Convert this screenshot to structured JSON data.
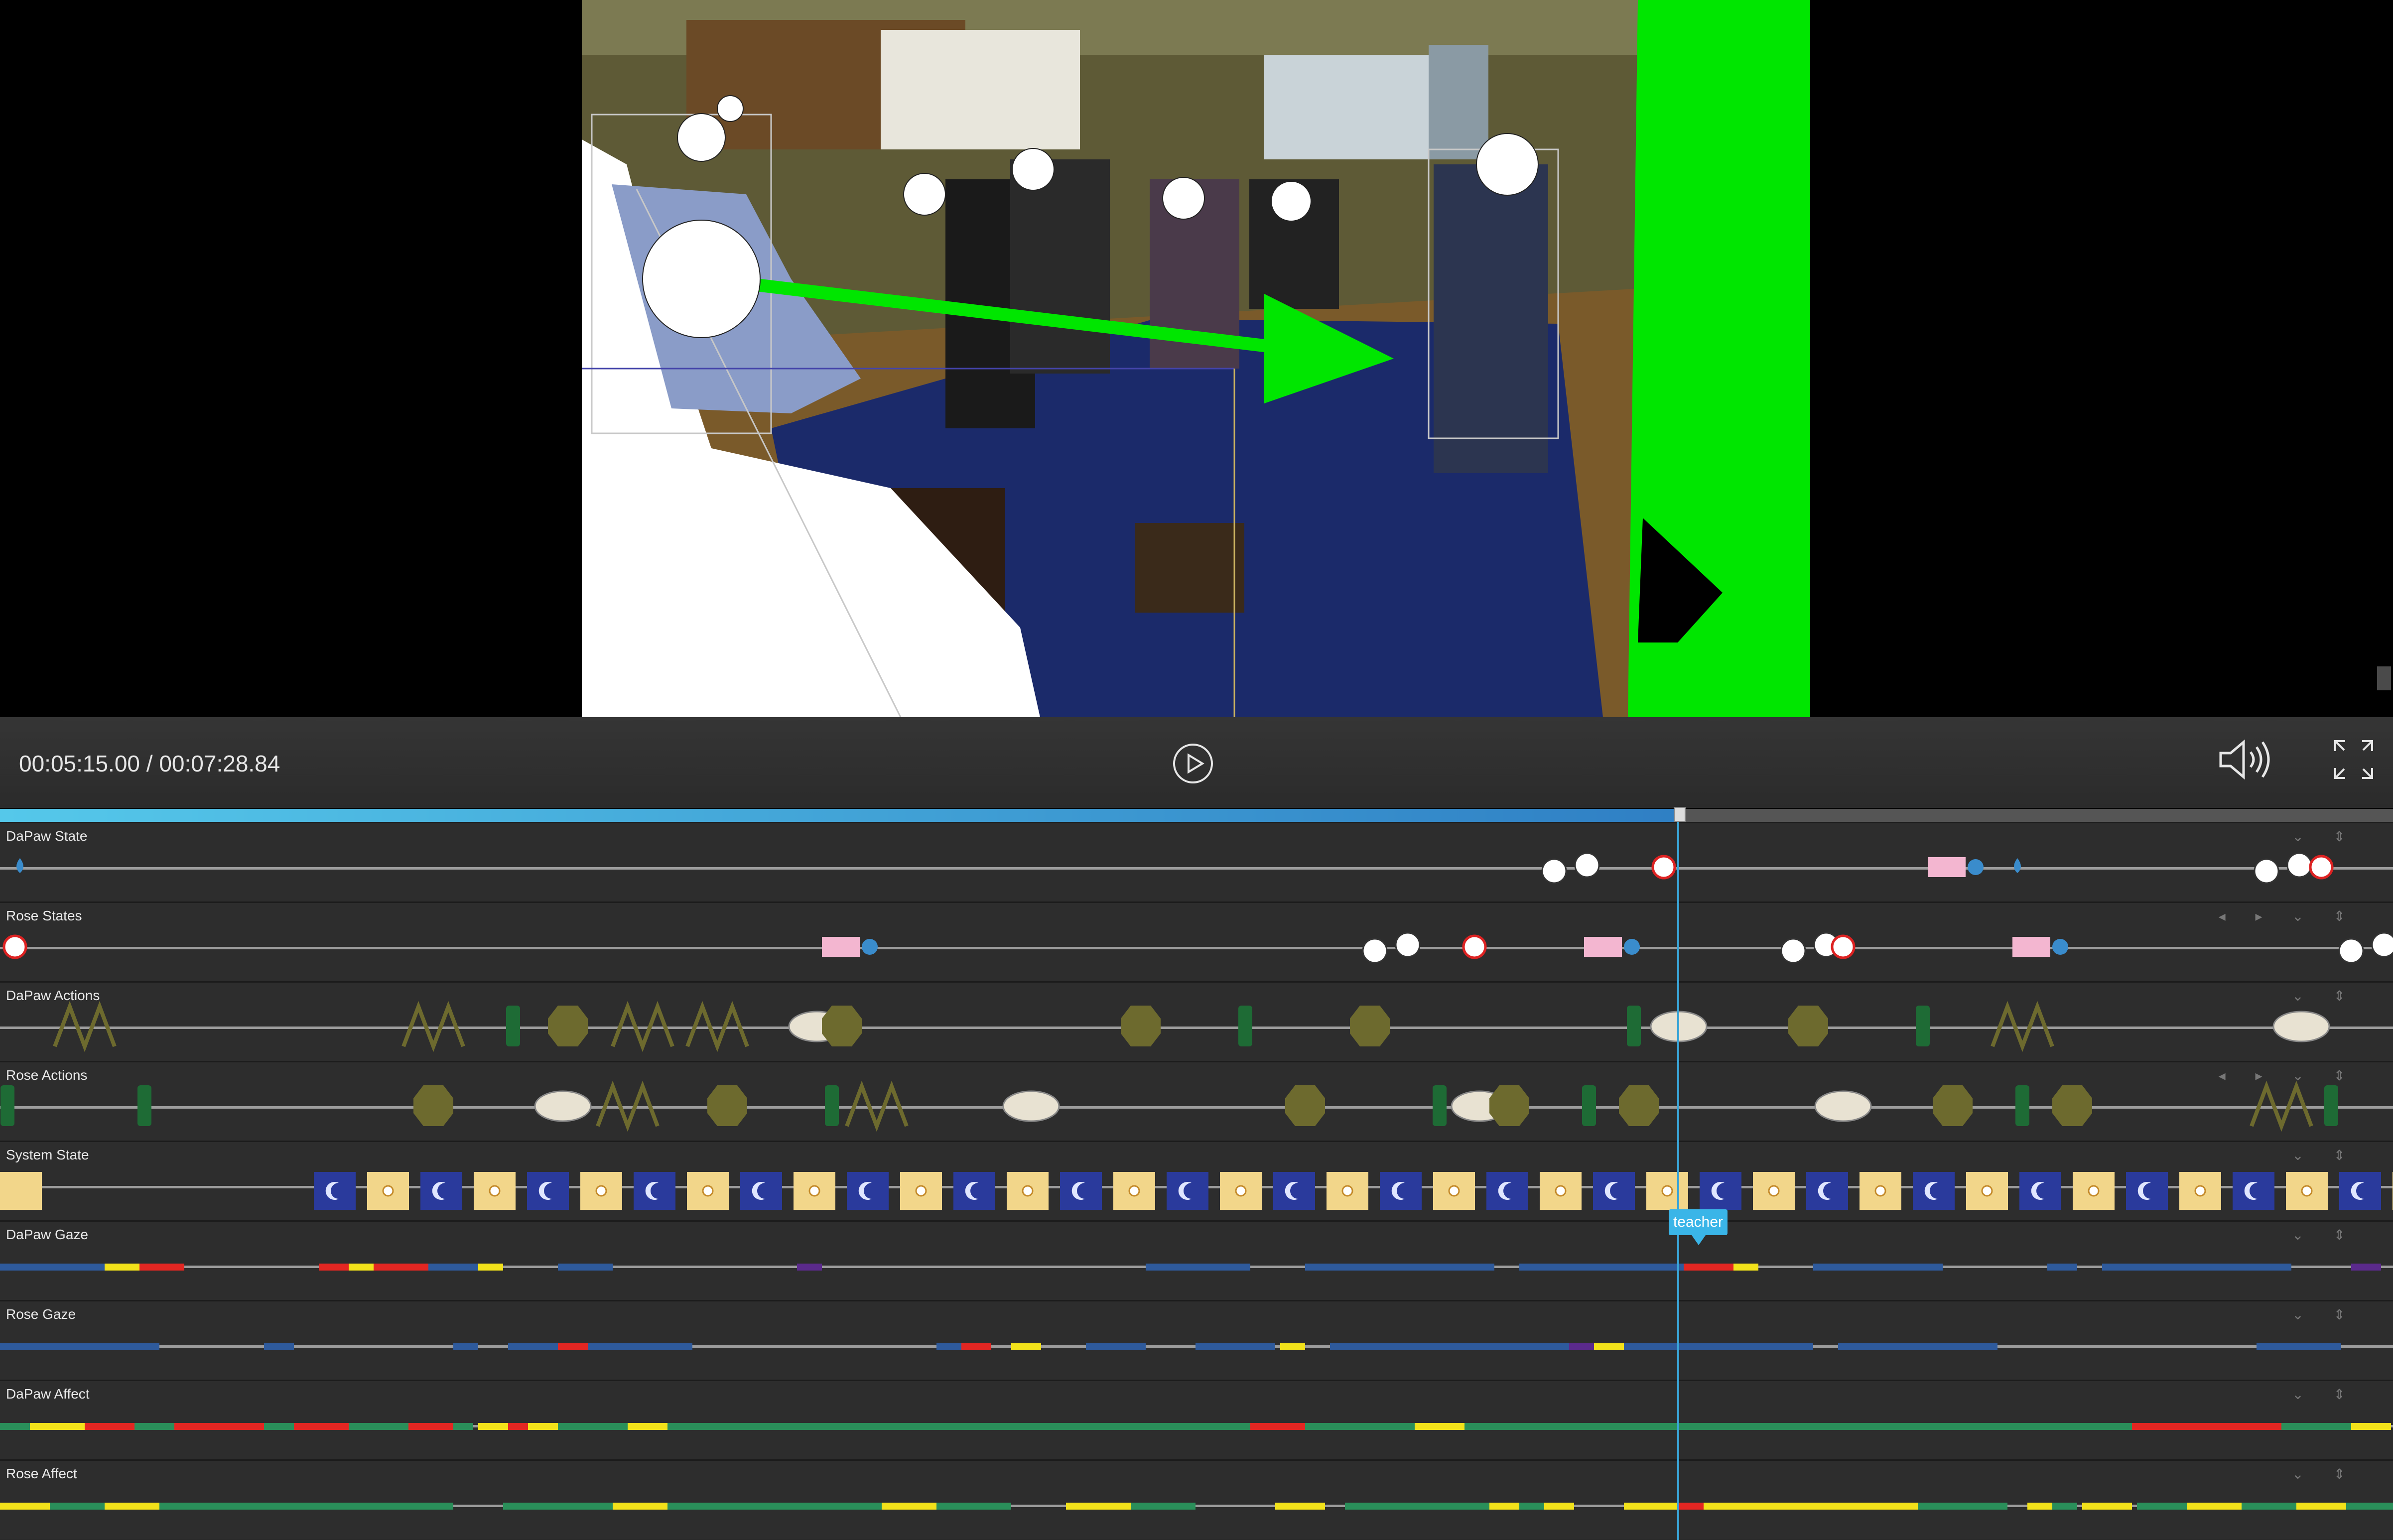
{
  "player": {
    "time_display": "00:05:15.00 / 00:07:28.84",
    "current_seconds": 315.0,
    "total_seconds": 448.84,
    "progress": 0.702,
    "play_icon": "play-circle-icon",
    "volume_icon": "speaker-volume-icon",
    "fullscreen_icon": "fullscreen-icon"
  },
  "overlay": {
    "gaze_arrow_color": "#00e600",
    "green_panel_color": "#00e600",
    "face_marker_color": "#ffffff"
  },
  "tracks": [
    {
      "label": "DaPaw State",
      "kind": "events",
      "tools": "⌄ ⇕"
    },
    {
      "label": "Rose States",
      "kind": "events",
      "tools": "◂ ▸ ⌄ ⇕"
    },
    {
      "label": "DaPaw Actions",
      "kind": "events",
      "tools": "⌄ ⇕"
    },
    {
      "label": "Rose Actions",
      "kind": "events",
      "tools": "◂ ▸ ⌄ ⇕"
    },
    {
      "label": "System State",
      "kind": "tiles",
      "tools": "⌄ ⇕"
    },
    {
      "label": "DaPaw Gaze",
      "kind": "segments",
      "tools": "⌄ ⇕"
    },
    {
      "label": "Rose Gaze",
      "kind": "segments",
      "tools": "⌄ ⇕"
    },
    {
      "label": "DaPaw Affect",
      "kind": "segments",
      "tools": "⌄ ⇕"
    },
    {
      "label": "Rose Affect",
      "kind": "segments",
      "tools": "⌄ ⇕"
    }
  ],
  "gaze_tooltip": "teacher",
  "colors": {
    "gaze_blue": "#2e5a9c",
    "red": "#e32622",
    "yellow": "#f2e21a",
    "purple": "#5b2a8c",
    "green": "#2a8f5a",
    "tile_yellow": "#f2d68a",
    "tile_blue": "#2a3a9c",
    "action_green": "#1e6b35",
    "action_olive": "#6d6a2e",
    "progress": "#2f7fc4"
  }
}
